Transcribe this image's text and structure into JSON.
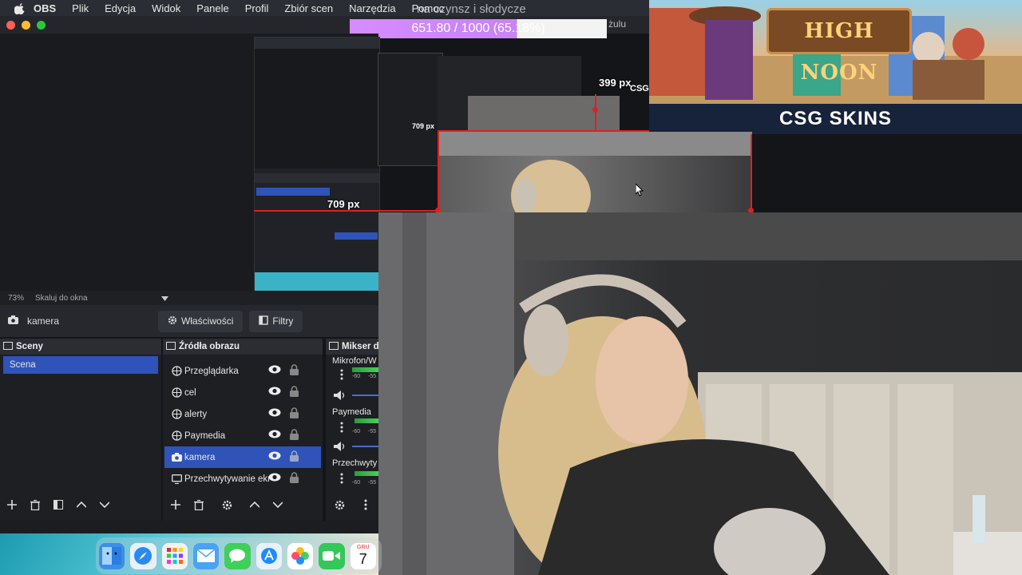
{
  "menubar": {
    "app": "OBS",
    "items": [
      "Plik",
      "Edycja",
      "Widok",
      "Panele",
      "Profil",
      "Zbiór scen",
      "Narzędzia",
      "Pomoc"
    ]
  },
  "window": {
    "title_tail": "żulu"
  },
  "overlay": {
    "goal_text": "na czynsz i słodycze",
    "counter": "651.80 / 1000 (65.18%)",
    "dim_709": "709 px",
    "dim_709_small": "709 px",
    "dim_399": "399 px",
    "csg_fragment": "CSG"
  },
  "banner": {
    "title": "HIGH NOON",
    "brand": "CSG SKINS"
  },
  "preview": {
    "zoom": "73%",
    "scale_mode": "Skaluj do okna"
  },
  "source_bar": {
    "selected_source": "kamera",
    "properties_label": "Właściwości",
    "filters_label": "Filtry"
  },
  "scenes": {
    "header": "Sceny",
    "items": [
      "Scena"
    ]
  },
  "sources": {
    "header": "Źródła obrazu",
    "items": [
      {
        "label": "Przeglądarka",
        "icon": "globe-icon"
      },
      {
        "label": "cel",
        "icon": "globe-icon"
      },
      {
        "label": "alerty",
        "icon": "globe-icon"
      },
      {
        "label": "Paymedia",
        "icon": "globe-icon"
      },
      {
        "label": "kamera",
        "icon": "camera-icon"
      },
      {
        "label": "Przechwytywanie ekr",
        "icon": "monitor-icon"
      }
    ],
    "selected_index": 4
  },
  "mixer": {
    "header": "Mikser d",
    "channels": [
      {
        "name": "Mikrofon/W",
        "ticks": [
          "-60",
          "-55"
        ]
      },
      {
        "name": "Paymedia",
        "ticks": [
          "-60",
          "-55"
        ]
      },
      {
        "name": "Przechwyty",
        "ticks": [
          "-60",
          "-55"
        ]
      }
    ]
  },
  "dock": {
    "calendar_day": "7",
    "calendar_month": "GRU"
  },
  "colors": {
    "selection_blue": "#2f53b8",
    "accent_red": "#e02020",
    "counter_purple": "#d58cff"
  }
}
